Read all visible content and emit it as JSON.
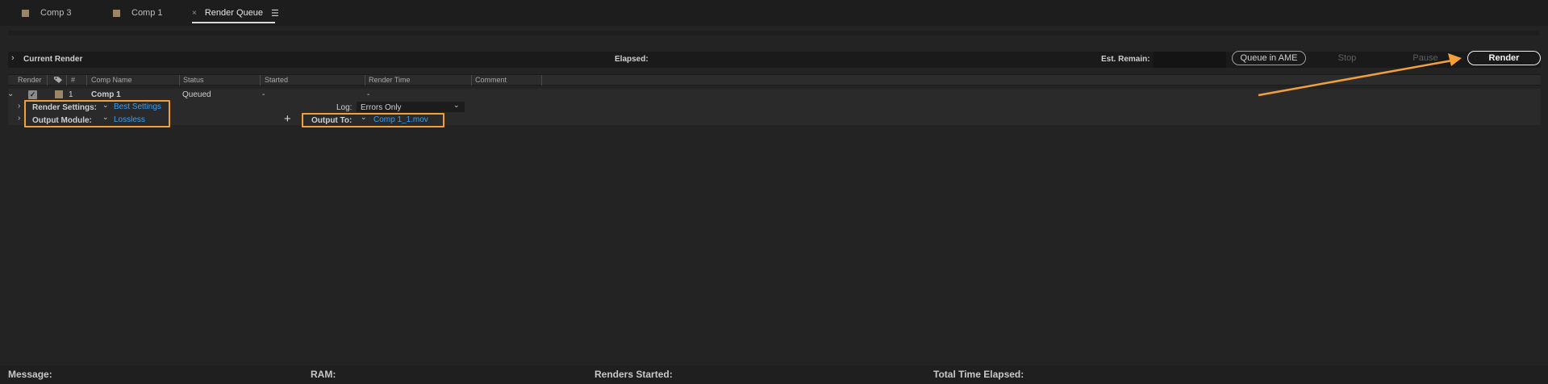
{
  "tabs": [
    {
      "label": "Comp 3"
    },
    {
      "label": "Comp 1"
    },
    {
      "label": "Render Queue",
      "close": "×",
      "menu": "☰"
    }
  ],
  "current_render": {
    "title": "Current Render",
    "elapsed_label": "Elapsed:",
    "remain_label": "Est. Remain:"
  },
  "buttons": {
    "queue_ame": "Queue in AME",
    "stop": "Stop",
    "pause": "Pause",
    "render": "Render"
  },
  "columns": {
    "render": "Render",
    "num": "#",
    "comp_name": "Comp Name",
    "status": "Status",
    "started": "Started",
    "render_time": "Render Time",
    "comment": "Comment"
  },
  "item": {
    "number": "1",
    "comp_name": "Comp 1",
    "status": "Queued",
    "started": "-",
    "render_time": "-",
    "checked": true
  },
  "render_settings": {
    "label": "Render Settings:",
    "value": "Best Settings"
  },
  "log": {
    "label": "Log:",
    "value": "Errors Only"
  },
  "output_module": {
    "label": "Output Module:",
    "value": "Lossless"
  },
  "output_to": {
    "label": "Output To:",
    "value": "Comp 1_1.mov"
  },
  "footer": {
    "message": "Message:",
    "ram": "RAM:",
    "renders_started": "Renders Started:",
    "total_time": "Total Time Elapsed:"
  },
  "colors": {
    "accent_highlight": "#f2a03a",
    "link": "#3b9cf0",
    "label_swatch": "#9b8765"
  },
  "icons": [
    "chevron-right-icon",
    "chevron-down-icon",
    "tag-icon",
    "checkbox-checked-icon",
    "plus-icon",
    "menu-icon",
    "close-icon"
  ]
}
